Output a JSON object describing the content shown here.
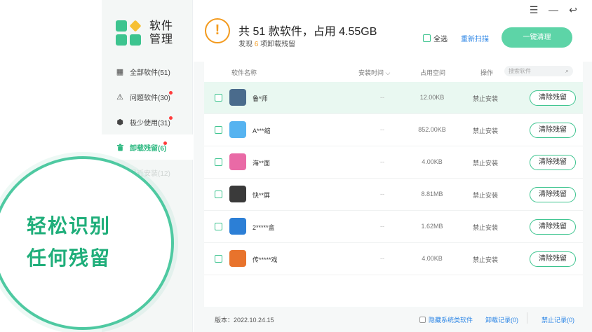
{
  "app": {
    "title_line1": "软件",
    "title_line2": "管理",
    "brand_colors": {
      "green": "#3dc48f",
      "yellow": "#f6c034"
    }
  },
  "window_controls": [
    {
      "icon": "menu-icon",
      "glyph": "☰"
    },
    {
      "icon": "minimize-icon",
      "glyph": "—"
    },
    {
      "icon": "back-icon",
      "glyph": "↩"
    }
  ],
  "sidebar": {
    "items": [
      {
        "label": "全部软件(51)",
        "icon": "grid-icon",
        "glyph": "▦",
        "badge": false,
        "active": false
      },
      {
        "label": "问题软件(30)",
        "icon": "warning-box-icon",
        "glyph": "⚠",
        "badge": true,
        "active": false
      },
      {
        "label": "极少使用(31)",
        "icon": "cube-icon",
        "glyph": "⬢",
        "badge": true,
        "active": false
      },
      {
        "label": "卸载残留(6)",
        "icon": "trash-icon",
        "glyph": "🗑",
        "badge": true,
        "active": true
      },
      {
        "label": "最近安装(12)",
        "icon": "clock-icon",
        "glyph": "◔",
        "badge": false,
        "active": false
      }
    ]
  },
  "header": {
    "title": "共 51 款软件，占用 4.55GB",
    "sub_prefix": "发现",
    "sub_num": "6",
    "sub_suffix": "项卸载残留",
    "select_all": "全选",
    "rescan": "重新扫描",
    "clean_all": "一键清理",
    "accent_color": "#f39a1d"
  },
  "table": {
    "columns": {
      "name": "软件名称",
      "time": "安装时间 ⌵",
      "size": "占用空间",
      "op": "操作"
    },
    "search_placeholder": "搜索软件",
    "rows": [
      {
        "name": "鲁*师",
        "time": "--",
        "size": "12.00KB",
        "status": "禁止安装",
        "action": "清除残留",
        "highlight": true,
        "icon_color": "#4a6b8c"
      },
      {
        "name": "A***缩",
        "time": "--",
        "size": "852.00KB",
        "status": "禁止安装",
        "action": "清除残留",
        "highlight": false,
        "icon_color": "#56b3f0"
      },
      {
        "name": "海**面",
        "time": "--",
        "size": "4.00KB",
        "status": "禁止安装",
        "action": "清除残留",
        "highlight": false,
        "icon_color": "#e96aa6"
      },
      {
        "name": "快**屏",
        "time": "--",
        "size": "8.81MB",
        "status": "禁止安装",
        "action": "清除残留",
        "highlight": false,
        "icon_color": "#3a3a3a"
      },
      {
        "name": "2*****盒",
        "time": "--",
        "size": "1.62MB",
        "status": "禁止安装",
        "action": "清除残留",
        "highlight": false,
        "icon_color": "#2c7fd6"
      },
      {
        "name": "传*****戏",
        "time": "--",
        "size": "4.00KB",
        "status": "禁止安装",
        "action": "清除残留",
        "highlight": false,
        "icon_color": "#e8732c"
      }
    ]
  },
  "footer": {
    "version": "版本：2022.10.24.15",
    "hide_system": "隐藏系统类软件",
    "uninstall_log": "卸载记录(0)",
    "ban_log": "禁止记录(0)"
  },
  "promo": {
    "line1": "轻松识别",
    "line2": "任何残留"
  }
}
